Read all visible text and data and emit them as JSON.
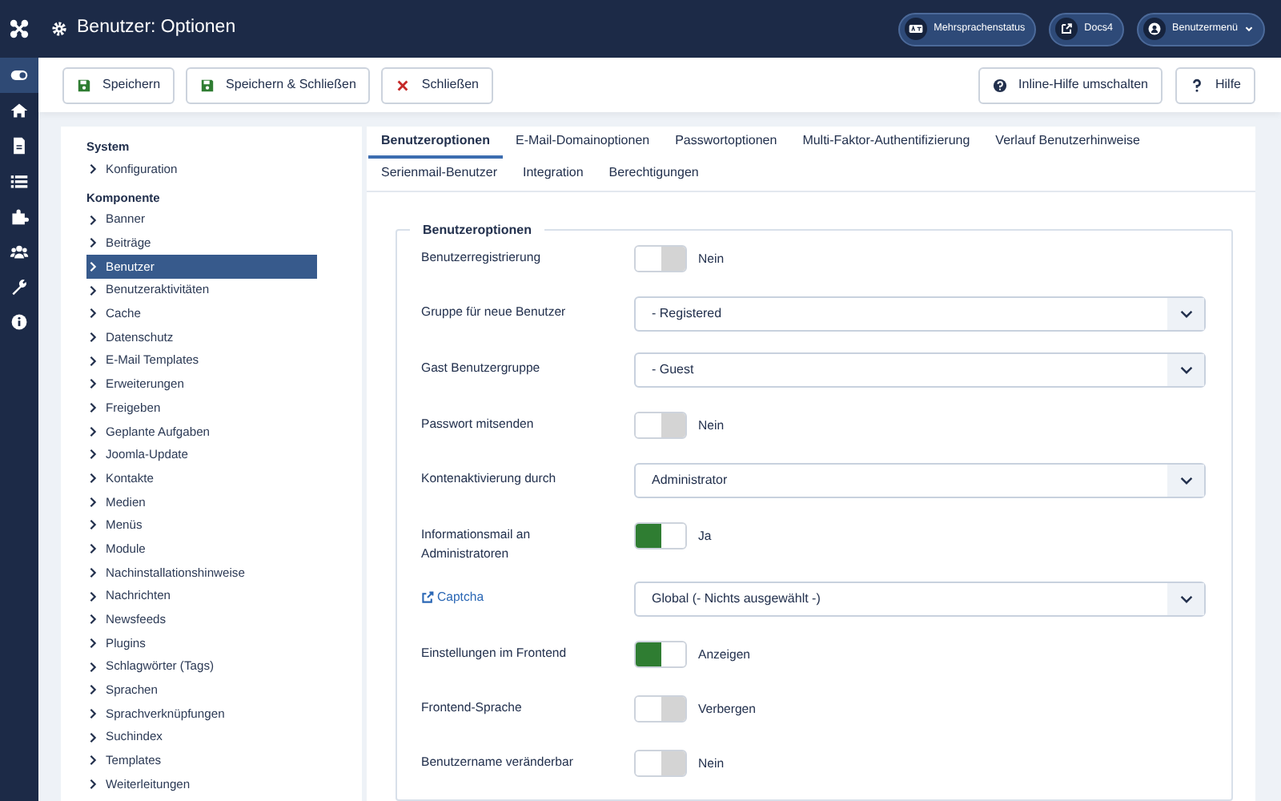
{
  "header": {
    "title": "Benutzer: Optionen"
  },
  "header_buttons": [
    {
      "label": "Mehrsprachenstatus",
      "kind": "language"
    },
    {
      "label": "Docs4",
      "kind": "external"
    },
    {
      "label": "Benutzermenü",
      "kind": "user"
    }
  ],
  "toolbar": [
    {
      "label": "Speichern",
      "kind": "save"
    },
    {
      "label": "Speichern & Schließen",
      "kind": "save"
    },
    {
      "label": "Schließen",
      "kind": "close"
    },
    {
      "label": "Inline-Hilfe umschalten",
      "kind": "help"
    },
    {
      "label": "Hilfe",
      "kind": "question"
    }
  ],
  "sidebar": [
    {
      "title": "System",
      "items": [
        {
          "label": "Konfiguration",
          "selected": false
        }
      ]
    },
    {
      "title": "Komponente",
      "items": [
        {
          "label": "Banner",
          "selected": false
        },
        {
          "label": "Beiträge",
          "selected": false
        },
        {
          "label": "Benutzer",
          "selected": true
        },
        {
          "label": "Benutzeraktivitäten",
          "selected": false
        },
        {
          "label": "Cache",
          "selected": false
        },
        {
          "label": "Datenschutz",
          "selected": false
        },
        {
          "label": "E-Mail Templates",
          "selected": false
        },
        {
          "label": "Erweiterungen",
          "selected": false
        },
        {
          "label": "Freigeben",
          "selected": false
        },
        {
          "label": "Geplante Aufgaben",
          "selected": false
        },
        {
          "label": "Joomla-Update",
          "selected": false
        },
        {
          "label": "Kontakte",
          "selected": false
        },
        {
          "label": "Medien",
          "selected": false
        },
        {
          "label": "Menüs",
          "selected": false
        },
        {
          "label": "Module",
          "selected": false
        },
        {
          "label": "Nachinstallationshinweise",
          "selected": false
        },
        {
          "label": "Nachrichten",
          "selected": false
        },
        {
          "label": "Newsfeeds",
          "selected": false
        },
        {
          "label": "Plugins",
          "selected": false
        },
        {
          "label": "Schlagwörter (Tags)",
          "selected": false
        },
        {
          "label": "Sprachen",
          "selected": false
        },
        {
          "label": "Sprachverknüpfungen",
          "selected": false
        },
        {
          "label": "Suchindex",
          "selected": false
        },
        {
          "label": "Templates",
          "selected": false
        },
        {
          "label": "Weiterleitungen",
          "selected": false
        }
      ]
    }
  ],
  "tab_rows": [
    [
      {
        "label": "Benutzeroptionen",
        "selected": true
      },
      {
        "label": "E-Mail-Domainoptionen",
        "selected": false
      },
      {
        "label": "Passwortoptionen",
        "selected": false
      },
      {
        "label": "Multi-Faktor-Authentifizierung",
        "selected": false
      },
      {
        "label": "Verlauf Benutzerhinweise",
        "selected": false
      }
    ],
    [
      {
        "label": "Serienmail-Benutzer",
        "selected": false
      },
      {
        "label": "Integration",
        "selected": false
      },
      {
        "label": "Berechtigungen",
        "selected": false
      }
    ]
  ],
  "fieldset": {
    "legend": "Benutzeroptionen",
    "fields": [
      {
        "label": "Benutzerregistrierung",
        "kind": "toggle",
        "on": false,
        "value": "Nein"
      },
      {
        "label": "Gruppe für neue Benutzer",
        "kind": "select",
        "value": "- Registered"
      },
      {
        "label": "Gast Benutzergruppe",
        "kind": "select",
        "value": "- Guest"
      },
      {
        "label": "Passwort mitsenden",
        "kind": "toggle",
        "on": false,
        "value": "Nein"
      },
      {
        "label": "Kontenaktivierung durch",
        "kind": "select",
        "value": "Administrator"
      },
      {
        "label": "Informationsmail an Administratoren",
        "kind": "toggle",
        "on": true,
        "value": "Ja"
      },
      {
        "label": "Captcha",
        "kind": "select",
        "link": true,
        "value": "Global (- Nichts ausgewählt -)"
      },
      {
        "label": "Einstellungen im Frontend",
        "kind": "toggle",
        "on": true,
        "value": "Anzeigen"
      },
      {
        "label": "Frontend-Sprache",
        "kind": "toggle",
        "on": false,
        "value": "Verbergen"
      },
      {
        "label": "Benutzername veränderbar",
        "kind": "toggle",
        "on": false,
        "value": "Nein"
      }
    ]
  }
}
